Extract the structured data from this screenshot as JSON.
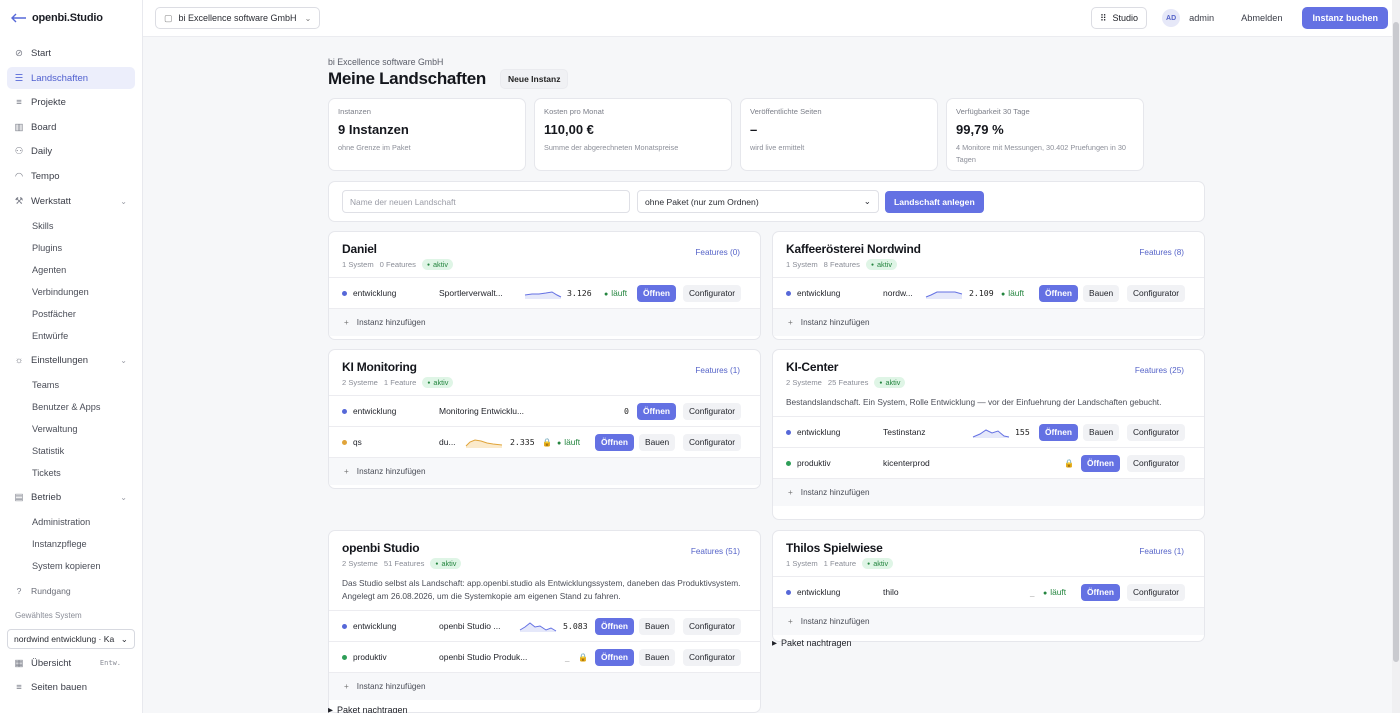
{
  "app": {
    "logo_text": "openbi.Studio"
  },
  "sidebar": {
    "items": [
      {
        "label": "Start"
      },
      {
        "label": "Landschaften"
      },
      {
        "label": "Projekte"
      },
      {
        "label": "Board"
      },
      {
        "label": "Daily"
      },
      {
        "label": "Tempo"
      },
      {
        "label": "Werkstatt"
      }
    ],
    "werkstatt_sub": [
      "Skills",
      "Plugins",
      "Agenten",
      "Verbindungen",
      "Postfächer",
      "Entwürfe"
    ],
    "einstellungen": "Einstellungen",
    "einstellungen_sub": [
      "Teams",
      "Benutzer & Apps",
      "Verwaltung",
      "Statistik",
      "Tickets"
    ],
    "betrieb": "Betrieb",
    "betrieb_sub": [
      "Administration",
      "Instanzpflege",
      "System kopieren"
    ],
    "rundgang": "Rundgang",
    "selected_system_label": "Gewähltes System",
    "selected_system": "nordwind entwicklung · Ka",
    "uebersicht": "Übersicht",
    "uebersicht_tag": "Entw.",
    "seiten_bauen": "Seiten bauen"
  },
  "topbar": {
    "org": "bi Excellence software GmbH",
    "studio": "Studio",
    "avatar": "AD",
    "user": "admin",
    "logout": "Abmelden",
    "buy": "Instanz buchen"
  },
  "page": {
    "org_name": "bi Excellence software GmbH",
    "title": "Meine Landschaften",
    "new_instance": "Neue Instanz"
  },
  "stats": [
    {
      "label": "Instanzen",
      "value": "9 Instanzen",
      "sub": "ohne Grenze im Paket"
    },
    {
      "label": "Kosten pro Monat",
      "value": "110,00 €",
      "sub": "Summe der abgerechneten Monatspreise"
    },
    {
      "label": "Veröffentlichte Seiten",
      "value": "–",
      "sub": "wird live ermittelt"
    },
    {
      "label": "Verfügbarkeit 30 Tage",
      "value": "99,79 %",
      "sub": "4 Monitore mit Messungen, 30.402 Pruefungen in 30 Tagen"
    }
  ],
  "create": {
    "placeholder": "Name der neuen Landschaft",
    "package": "ohne Paket (nur zum Ordnen)",
    "button": "Landschaft anlegen"
  },
  "common": {
    "open": "Öffnen",
    "build": "Bauen",
    "configurator": "Configurator",
    "running": "läuft",
    "add_instance": "Instanz hinzufügen",
    "paket": "Paket nachtragen",
    "active": "aktiv"
  },
  "colors": {
    "accent": "#6471e3",
    "dev": "#5668d8",
    "qs": "#e0a43a",
    "prod": "#2e9e58"
  },
  "cards": [
    {
      "title": "Daniel",
      "meta": [
        "1 System",
        "0 Features"
      ],
      "features": "Features (0)",
      "rows": [
        {
          "env": "entwicklung",
          "name": "Sportlerverwalt...",
          "num": "3.126"
        }
      ]
    },
    {
      "title": "Kaffeerösterei Nordwind",
      "meta": [
        "1 System",
        "8 Features"
      ],
      "features": "Features (8)",
      "rows": [
        {
          "env": "entwicklung",
          "name": "nordw...",
          "num": "2.109"
        }
      ]
    },
    {
      "title": "KI Monitoring",
      "meta": [
        "2 Systeme",
        "1 Feature"
      ],
      "features": "Features (1)",
      "rows": [
        {
          "env": "entwicklung",
          "name": "Monitoring Entwicklu...",
          "num": "0"
        },
        {
          "env": "qs",
          "name": "du...",
          "num": "2.335"
        }
      ]
    },
    {
      "title": "KI-Center",
      "meta": [
        "2 Systeme",
        "25 Features"
      ],
      "features": "Features (25)",
      "desc": "Bestandslandschaft. Ein System, Rolle Entwicklung — vor der Einfuehrung der Landschaften gebucht.",
      "rows": [
        {
          "env": "entwicklung",
          "name": "Testinstanz",
          "num": "155"
        },
        {
          "env": "produktiv",
          "name": "kicenterprod"
        }
      ]
    },
    {
      "title": "openbi Studio",
      "meta": [
        "2 Systeme",
        "51 Features"
      ],
      "features": "Features (51)",
      "desc": "Das Studio selbst als Landschaft: app.openbi.studio als Entwicklungssystem, daneben das Produktivsystem. Angelegt am 26.08.2026, um die Systemkopie am eigenen Stand zu fahren.",
      "rows": [
        {
          "env": "entwicklung",
          "name": "openbi Studio ...",
          "num": "5.083"
        },
        {
          "env": "produktiv",
          "name": "openbi Studio Produk..."
        }
      ]
    },
    {
      "title": "Thilos Spielwiese",
      "meta": [
        "1 System",
        "1 Feature"
      ],
      "features": "Features (1)",
      "rows": [
        {
          "env": "entwicklung",
          "name": "thilo"
        }
      ]
    }
  ]
}
